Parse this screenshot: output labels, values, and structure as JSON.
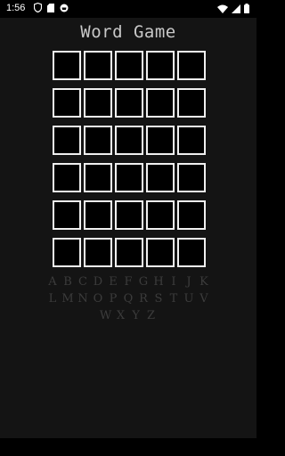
{
  "status": {
    "time": "1:56"
  },
  "app": {
    "title": "Word Game"
  },
  "grid": {
    "rows": 6,
    "cols": 5
  },
  "keyboard": {
    "rows": [
      [
        "A",
        "B",
        "C",
        "D",
        "E",
        "F",
        "G",
        "H",
        "I",
        "J",
        "K"
      ],
      [
        "L",
        "M",
        "N",
        "O",
        "P",
        "Q",
        "R",
        "S",
        "T",
        "U",
        "V"
      ],
      [
        "W",
        "X",
        "Y",
        "Z"
      ]
    ]
  }
}
